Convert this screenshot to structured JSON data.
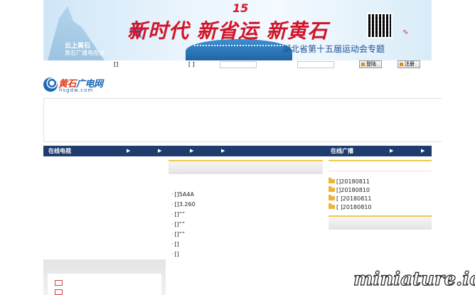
{
  "banner": {
    "slogan": "新时代 新省运 新黄石",
    "edition_mark": "15",
    "subtitle": "湖北省第十五届运动会专题",
    "logo_line1": "云上黄石",
    "logo_line2": "黄石广播电视台",
    "accent_color": "#d2142a"
  },
  "login": {
    "label_user": "[]",
    "label_pass": "[ ]",
    "login_button": "登陆",
    "register_button": "注册"
  },
  "site": {
    "name_prefix": "黄石",
    "name_suffix": "广电网",
    "domain": "hsgdw.com"
  },
  "nav": {
    "left_title": "在线电视",
    "right_title": "在线广播",
    "arrows": [
      "▶",
      "▶",
      "▶",
      "▶",
      "▶",
      "▶"
    ]
  },
  "middle_list": [
    "[]5A4A",
    "[]3.260",
    "[]“”",
    "[]“”",
    "[]“”",
    "[]",
    "[]"
  ],
  "right_list": [
    "[]20180811",
    "[]20180810",
    "[   ]20180811",
    "[   ]20180810"
  ],
  "watermark": "miniature.io"
}
